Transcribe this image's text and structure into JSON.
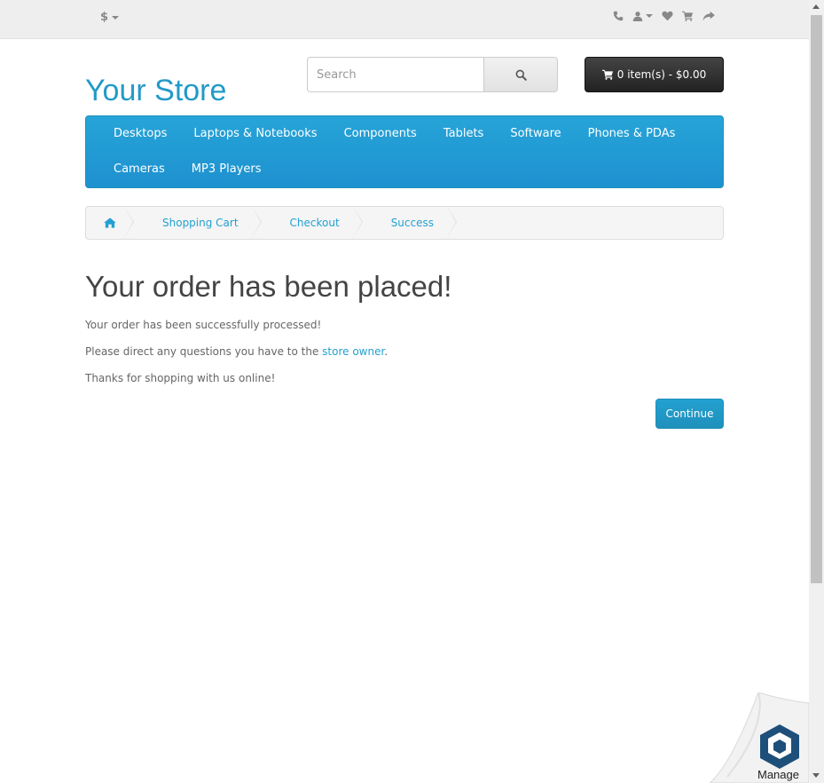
{
  "topbar": {
    "currency": "$",
    "icons": [
      "phone-icon",
      "user-icon",
      "heart-icon",
      "cart-icon",
      "share-icon"
    ]
  },
  "header": {
    "logo": "Your Store",
    "search_placeholder": "Search",
    "cart_label": "0 item(s) - $0.00"
  },
  "menu": {
    "items": [
      "Desktops",
      "Laptops & Notebooks",
      "Components",
      "Tablets",
      "Software",
      "Phones & PDAs",
      "Cameras",
      "MP3 Players"
    ]
  },
  "breadcrumb": {
    "items": [
      "Shopping Cart",
      "Checkout",
      "Success"
    ]
  },
  "content": {
    "title": "Your order has been placed!",
    "line1": "Your order has been successfully processed!",
    "line2_prefix": "Please direct any questions you have to the ",
    "line2_link": "store owner",
    "line2_suffix": ".",
    "line3": "Thanks for shopping with us online!",
    "continue_label": "Continue"
  },
  "widget": {
    "label": "Manage"
  },
  "colors": {
    "accent": "#229ac8",
    "menu": "#229ac8",
    "cart_button": "#303030"
  }
}
